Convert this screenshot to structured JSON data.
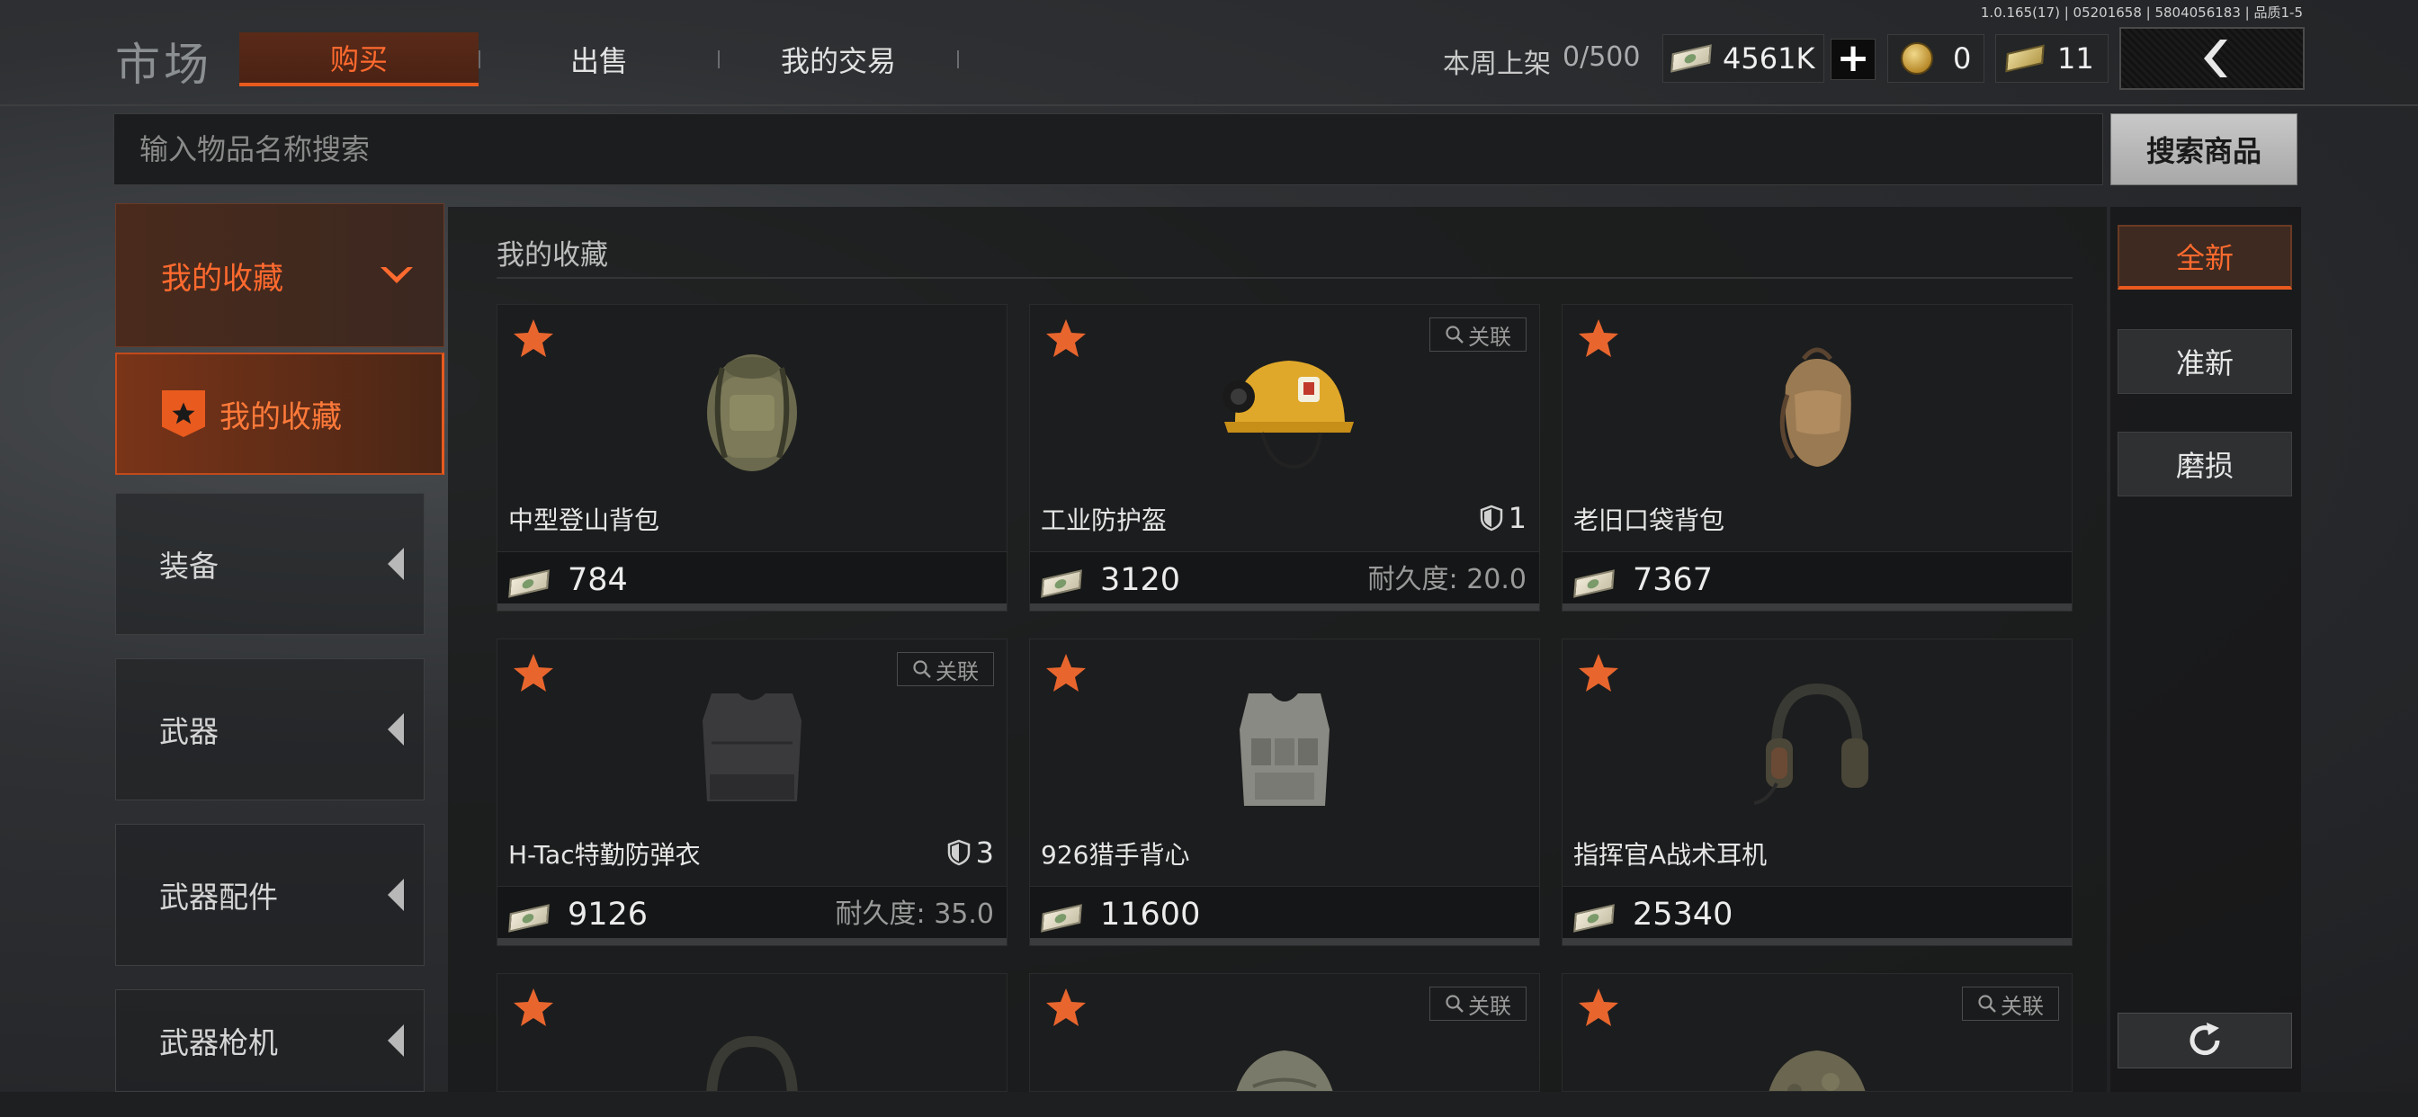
{
  "version_text": "1.0.165(17) | 05201658 | 5804056183 | 品质1-5",
  "header": {
    "title": "市场",
    "tabs": [
      {
        "label": "购买",
        "active": true
      },
      {
        "label": "出售",
        "active": false
      },
      {
        "label": "我的交易",
        "active": false
      }
    ],
    "weekly_label": "本周上架",
    "weekly_value": "0/500",
    "cash_amount": "4561K",
    "coin_amount": "0",
    "bill_amount": "11"
  },
  "search": {
    "placeholder": "输入物品名称搜索",
    "button_label": "搜索商品"
  },
  "sidebar": {
    "favorites_header": "我的收藏",
    "favorites_item": "我的收藏",
    "items": [
      {
        "label": "装备"
      },
      {
        "label": "武器"
      },
      {
        "label": "武器配件"
      },
      {
        "label": "武器枪机"
      }
    ]
  },
  "main": {
    "section_title": "我的收藏",
    "link_label": "关联",
    "durability_label": "耐久度:",
    "cards": [
      {
        "name": "中型登山背包",
        "price": "784",
        "has_link": false
      },
      {
        "name": "工业防护盔",
        "price": "3120",
        "armor": "1",
        "durability": "20.0",
        "has_link": true
      },
      {
        "name": "老旧口袋背包",
        "price": "7367",
        "has_link": false
      },
      {
        "name": "H-Tac特勤防弹衣",
        "price": "9126",
        "armor": "3",
        "durability": "35.0",
        "has_link": true
      },
      {
        "name": "926猎手背心",
        "price": "11600",
        "has_link": false
      },
      {
        "name": "指挥官A战术耳机",
        "price": "25340",
        "has_link": false
      }
    ]
  },
  "filters": {
    "items": [
      {
        "label": "全新",
        "active": true
      },
      {
        "label": "准新",
        "active": false
      },
      {
        "label": "磨损",
        "active": false
      }
    ]
  },
  "colors": {
    "accent": "#e85a1e",
    "accent_text": "#ff6a2e"
  }
}
